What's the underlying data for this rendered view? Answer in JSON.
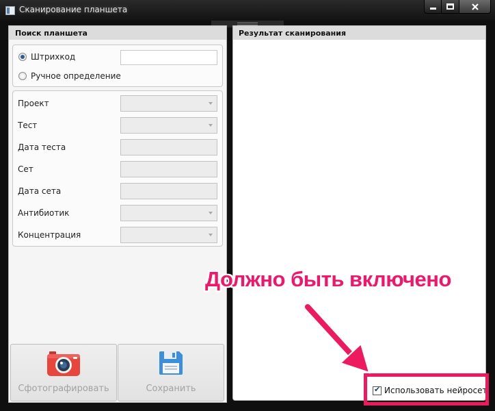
{
  "window": {
    "title": "Сканирование планшета",
    "app_icon": "window-app-icon",
    "controls": [
      "minimize-icon",
      "maximize-icon",
      "close-icon"
    ]
  },
  "left_pane": {
    "header": "Поиск планшета",
    "search_mode": {
      "options": [
        {
          "label": "Штрихкод",
          "selected": true
        },
        {
          "label": "Ручное определение",
          "selected": false
        }
      ],
      "barcode_value": ""
    },
    "fields": [
      {
        "label": "Проект",
        "type": "dropdown",
        "value": ""
      },
      {
        "label": "Тест",
        "type": "dropdown",
        "value": ""
      },
      {
        "label": "Дата теста",
        "type": "text",
        "value": ""
      },
      {
        "label": "Сет",
        "type": "text",
        "value": ""
      },
      {
        "label": "Дата сета",
        "type": "text",
        "value": ""
      },
      {
        "label": "Антибиотик",
        "type": "dropdown",
        "value": ""
      },
      {
        "label": "Концентрация",
        "type": "dropdown",
        "value": ""
      }
    ],
    "buttons": {
      "photo": {
        "label": "Сфотографировать",
        "icon": "camera-icon"
      },
      "save": {
        "label": "Сохранить",
        "icon": "floppy-disk-icon"
      }
    }
  },
  "right_pane": {
    "header": "Результат сканирования",
    "use_neural_network": {
      "label": "Использовать нейросеть",
      "checked": true
    }
  },
  "annotation": {
    "text": "Должно быть включено",
    "color": "#F2166A"
  },
  "colors": {
    "highlight": "#EE1A60",
    "camera_red": "#E8453C",
    "floppy_blue": "#3D8FD9"
  }
}
